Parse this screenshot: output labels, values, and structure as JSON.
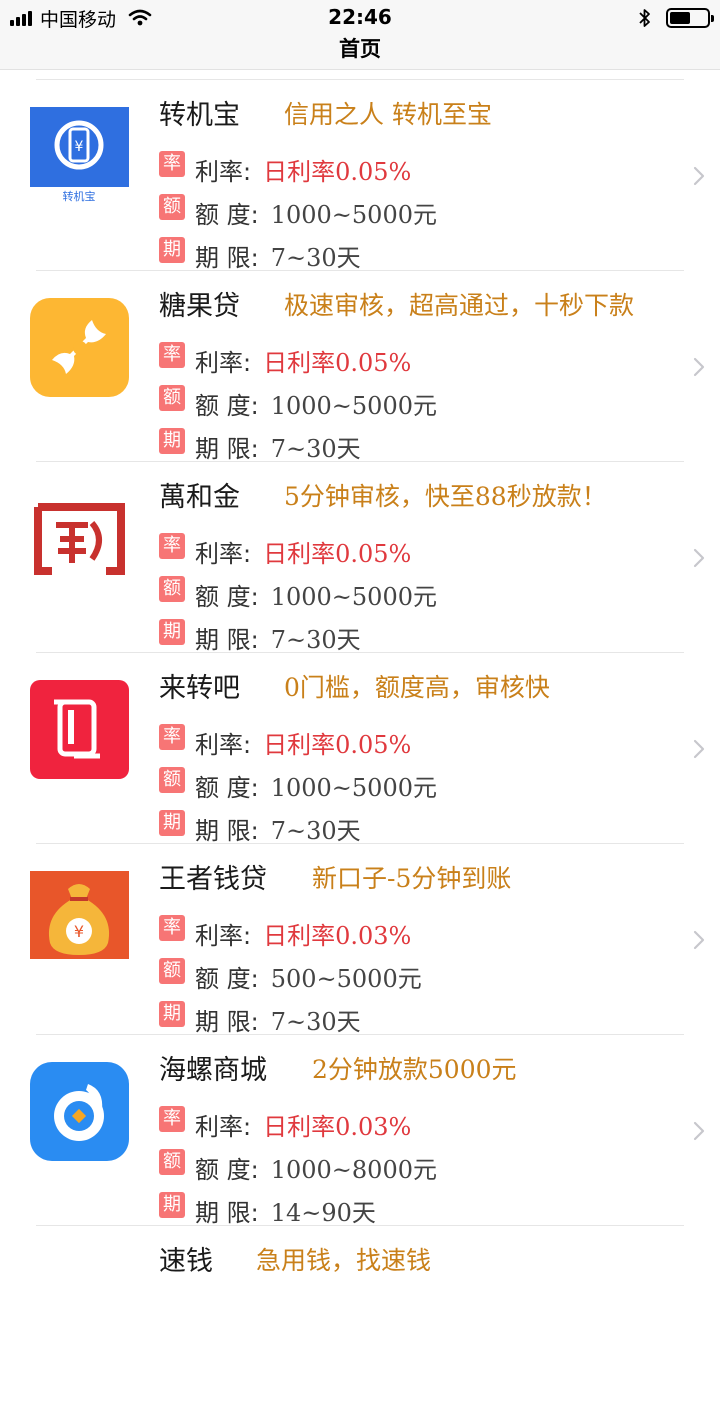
{
  "status": {
    "carrier": "中国移动",
    "time": "22:46",
    "battery_level": 0.55
  },
  "nav": {
    "title": "首页"
  },
  "tags": {
    "rate": "率",
    "amount": "额",
    "term": "期"
  },
  "labels": {
    "rate": "利率:",
    "amount": "额 度:",
    "term": "期 限:"
  },
  "colors": {
    "slogan": "#c9801a",
    "rate_value": "#e0393e",
    "tag_bg": "#f77575"
  },
  "products": [
    {
      "name": "转机宝",
      "slogan": "信用之人 转机至宝",
      "rate": "日利率0.05%",
      "amount": "1000~5000元",
      "term": "7~30天",
      "logo_text": "转机宝",
      "logo_icon": "phone-yen-icon"
    },
    {
      "name": "糖果贷",
      "slogan": "极速审核，超高通过，十秒下款",
      "rate": "日利率0.05%",
      "amount": "1000~5000元",
      "term": "7~30天",
      "logo_icon": "candy-icon"
    },
    {
      "name": "萬和金",
      "slogan": "5分钟审核，快至88秒放款！",
      "rate": "日利率0.05%",
      "amount": "1000~5000元",
      "term": "7~30天",
      "logo_icon": "seal-icon"
    },
    {
      "name": "来转吧",
      "slogan": "0门槛，额度高，审核快",
      "rate": "日利率0.05%",
      "amount": "1000~5000元",
      "term": "7~30天",
      "logo_icon": "phone-icon"
    },
    {
      "name": "王者钱贷",
      "slogan": "新口子-5分钟到账",
      "rate": "日利率0.03%",
      "amount": "500~5000元",
      "term": "7~30天",
      "logo_icon": "money-bag-icon"
    },
    {
      "name": "海螺商城",
      "slogan": "2分钟放款5000元",
      "rate": "日利率0.03%",
      "amount": "1000~8000元",
      "term": "14~90天",
      "logo_icon": "conch-icon"
    },
    {
      "name": "速钱",
      "slogan": "急用钱，找速钱"
    }
  ]
}
